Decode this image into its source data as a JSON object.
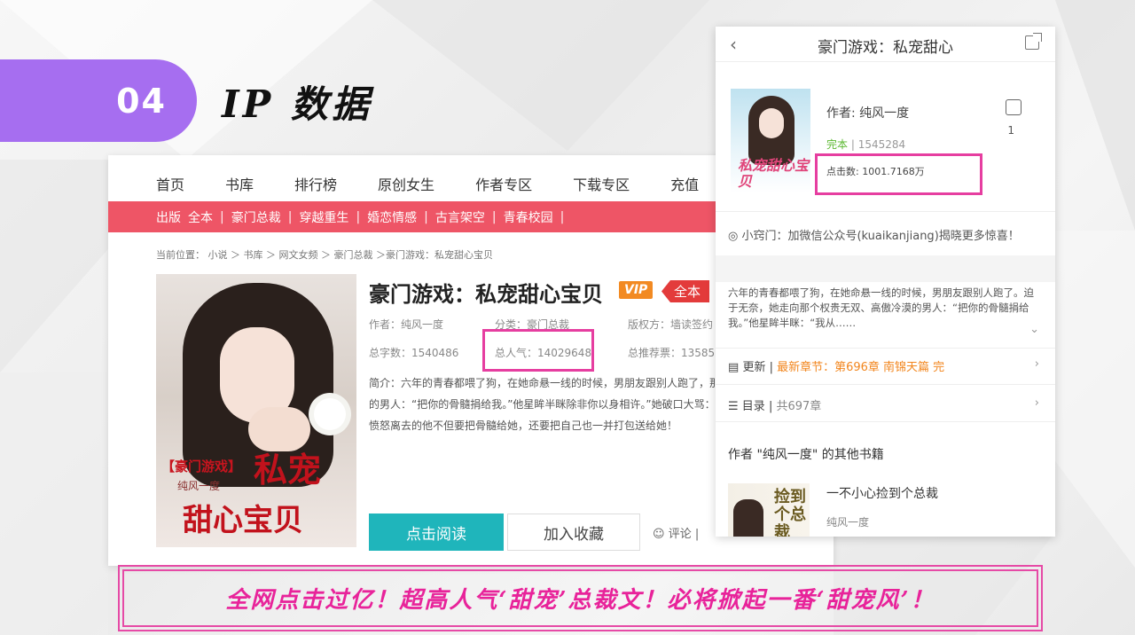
{
  "slide": {
    "number": "04",
    "title": "IP 数据",
    "banner": "全网点击过亿！超高人气‘甜宠’总裁文！必将掀起一番‘甜宠风’！"
  },
  "web": {
    "nav": [
      "首页",
      "书库",
      "排行榜",
      "原创女生",
      "作者专区",
      "下载专区",
      "充值"
    ],
    "categories": [
      "出版",
      "全本",
      "豪门总裁",
      "穿越重生",
      "婚恋情感",
      "古言架空",
      "青春校园"
    ],
    "breadcrumb": "当前位置： 小说 ＞ 书库 ＞ 网文女频 ＞ 豪门总裁 ＞豪门游戏：私宠甜心宝贝",
    "book": {
      "title": "豪门游戏：私宠甜心宝贝",
      "vip": "VIP",
      "full": "全本",
      "author": "作者：纯风一度",
      "category": "分类：豪门总裁",
      "rights": "版权方：墙读签约",
      "words": "总字数：1540486",
      "popularity": "总人气：14029648",
      "recommend": "总推荐票：13585",
      "intro": "简介：六年的青春都喂了狗，在她命悬一线的时候，男朋友跟别人跑了，那个权贵无双、高傲冷漠的男人：“把你的骨髓捐给我。”他星眸半眯除非你以身相许。”她破口大骂：“你有病！”男人看着她愤怒离去的他不但要把骨髓给她，还要把自己也一并打包送给她！",
      "cover_tag": "【豪门游戏】",
      "cover_author": "纯风一度",
      "cover_title_1": "私宠",
      "cover_title_2": "甜心宝贝"
    },
    "read_button": "点击阅读",
    "fav_button": "加入收藏",
    "comment": "评论 |"
  },
  "phone": {
    "title": "豪门游戏：私宠甜心",
    "author": "作者: 纯风一度",
    "likes": "1",
    "status_done": "完本",
    "status_sep": " | ",
    "status_words": "1545284",
    "clicks": "点击数: 1001.7168万",
    "cover_text": "私宠甜心宝贝",
    "tip": "小窍门：加微信公众号(kuaikanjiang)揭晓更多惊喜！",
    "intro": "六年的青春都喂了狗，在她命悬一线的时候，男朋友跟别人跑了。迫于无奈，她走向那个权贵无双、高傲冷漠的男人：“把你的骨髓捐给我。”他星眸半眯：“我从……",
    "update_label": "更新",
    "update_value": "最新章节：第696章 南锦天篇 完",
    "toc_label": "目录",
    "toc_value": "共697章",
    "other_books": "作者 \"纯风一度\" 的其他书籍",
    "other_book_title": "一不小心捡到个总裁",
    "other_book_author": "纯风一度",
    "other_book_cover": "捡到个总裁"
  },
  "colors": {
    "accent_purple": "#a66ef0",
    "highlight_pink": "#e63ea0",
    "category_red": "#ee5566",
    "read_teal": "#1fb5bb"
  }
}
